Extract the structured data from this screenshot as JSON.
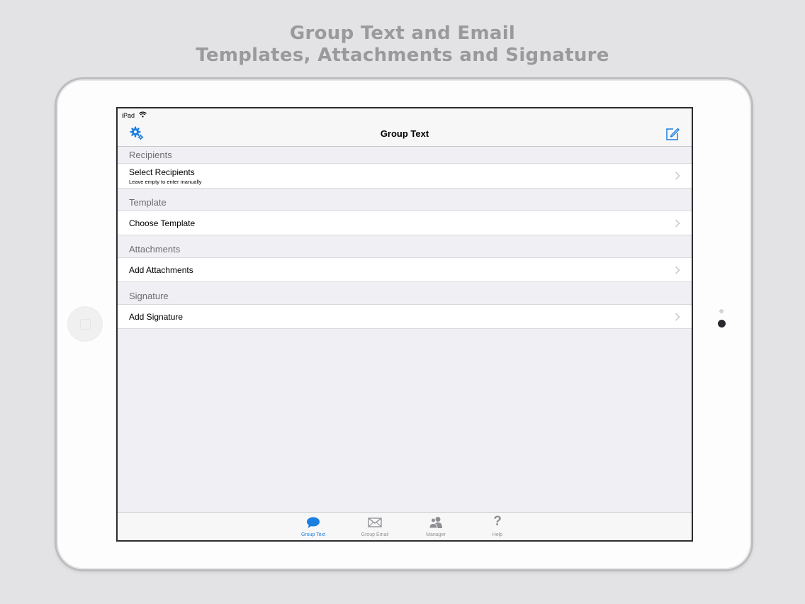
{
  "promo": {
    "line1": "Group Text and Email",
    "line2": "Templates, Attachments and Signature"
  },
  "statusbar": {
    "device": "iPad"
  },
  "navbar": {
    "title": "Group Text"
  },
  "sections": [
    {
      "header": "Recipients",
      "row_label": "Select Recipients",
      "row_sublabel": "Leave empty to enter manually"
    },
    {
      "header": "Template",
      "row_label": "Choose Template"
    },
    {
      "header": "Attachments",
      "row_label": "Add Attachments"
    },
    {
      "header": "Signature",
      "row_label": "Add Signature"
    }
  ],
  "tabs": [
    {
      "label": "Group Text",
      "icon": "speech-bubble-icon",
      "active": true
    },
    {
      "label": "Group Email",
      "icon": "envelope-icon",
      "active": false
    },
    {
      "label": "Manager",
      "icon": "people-icon",
      "active": false
    },
    {
      "label": "Help",
      "icon": "question-mark-icon",
      "active": false
    }
  ],
  "colors": {
    "accent": "#1a7fe0",
    "inactive": "#929292",
    "background": "#efeff4"
  }
}
